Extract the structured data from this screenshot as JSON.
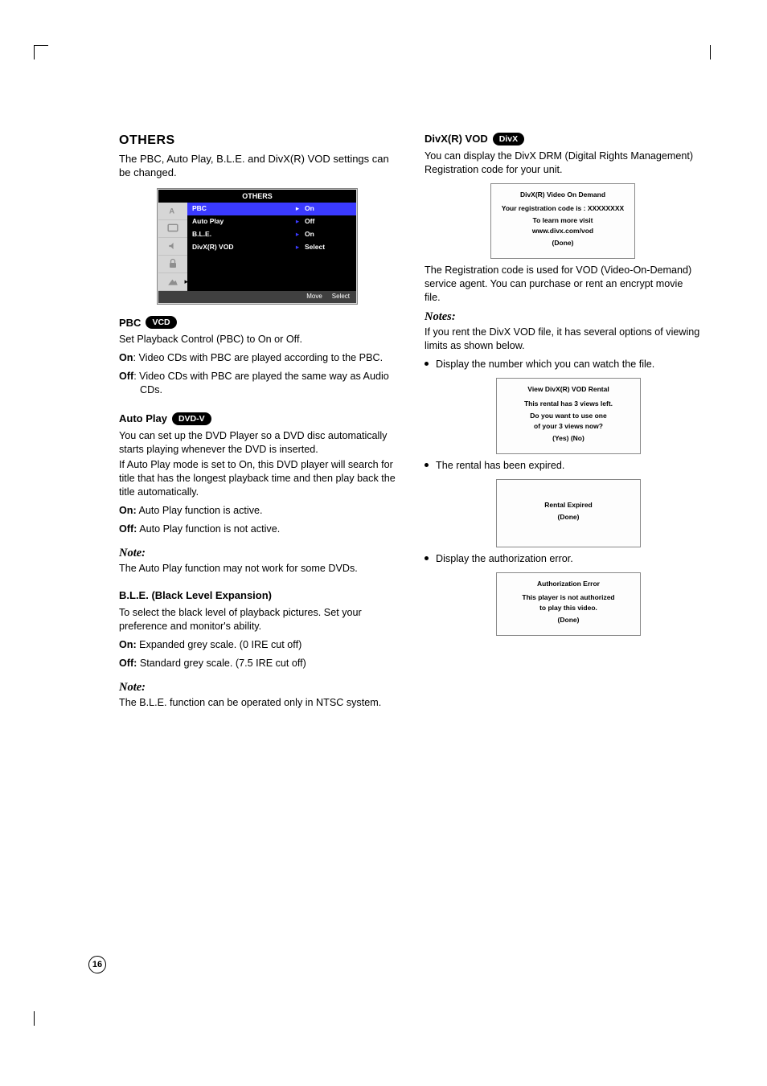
{
  "page_number": "16",
  "left": {
    "heading": "OTHERS",
    "intro": "The PBC, Auto Play, B.L.E. and DivX(R) VOD settings can be changed.",
    "menu": {
      "title": "OTHERS",
      "rows": [
        {
          "label": "PBC",
          "value": "On",
          "selected": true
        },
        {
          "label": "Auto Play",
          "value": "Off",
          "selected": false
        },
        {
          "label": "B.L.E.",
          "value": "On",
          "selected": false
        },
        {
          "label": "DivX(R)  VOD",
          "value": "Select",
          "selected": false
        }
      ],
      "footer": {
        "move": "Move",
        "select": "Select"
      }
    },
    "pbc": {
      "title": "PBC",
      "badge": "VCD",
      "desc": "Set Playback Control (PBC) to On or Off.",
      "on_label": "On",
      "on_text": ": Video CDs with PBC are played according to the PBC.",
      "off_label": "Off",
      "off_text": ": Video CDs with PBC are played the same way as Audio CDs."
    },
    "autoplay": {
      "title": "Auto Play",
      "badge": "DVD-V",
      "p1": "You can set up the DVD Player so a DVD disc automatically starts playing whenever the DVD is inserted.",
      "p2": "If Auto Play mode is set to On, this DVD player will search for title that has the longest playback time and then play back the title automatically.",
      "on_label": "On:",
      "on_text": " Auto Play function is active.",
      "off_label": "Off:",
      "off_text": " Auto Play function is not active.",
      "note_h": "Note:",
      "note": "The Auto Play function may not work for some DVDs."
    },
    "ble": {
      "title": "B.L.E. (Black Level Expansion)",
      "desc": "To select the black level of playback pictures. Set your preference and monitor's ability.",
      "on_label": "On:",
      "on_text": " Expanded grey scale. (0 IRE cut off)",
      "off_label": "Off:",
      "off_text": " Standard grey scale. (7.5 IRE cut off)",
      "note_h": "Note:",
      "note": "The B.L.E. function can be operated only in NTSC system."
    }
  },
  "right": {
    "heading": "DivX(R) VOD",
    "badge": "DivX",
    "p1": "You can display the DivX DRM (Digital Rights Management) Registration code for your unit.",
    "dialog1": {
      "title": "DivX(R) Video On Demand",
      "line1": "Your registration code is : XXXXXXXX",
      "line2a": "To learn more visit",
      "line2b": "www.divx.com/vod",
      "done": "(Done)"
    },
    "p2": "The Registration code is used for VOD (Video-On-Demand) service agent. You can purchase or rent an encrypt movie file.",
    "notes_h": "Notes:",
    "notes_intro": "If you rent the DivX VOD file, it has several options of viewing limits as shown below.",
    "b1": "Display the number which you can watch the file.",
    "dialog2": {
      "title": "View DivX(R) VOD Rental",
      "line1": "This rental has 3 views left.",
      "line2a": "Do you want to use one",
      "line2b": "of your 3 views now?",
      "yesno": "(Yes) (No)"
    },
    "b2": "The rental has been expired.",
    "dialog3": {
      "title": "Rental Expired",
      "done": "(Done)"
    },
    "b3": "Display the authorization error.",
    "dialog4": {
      "title": "Authorization Error",
      "line1a": "This player is not authorized",
      "line1b": "to play this video.",
      "done": "(Done)"
    }
  }
}
